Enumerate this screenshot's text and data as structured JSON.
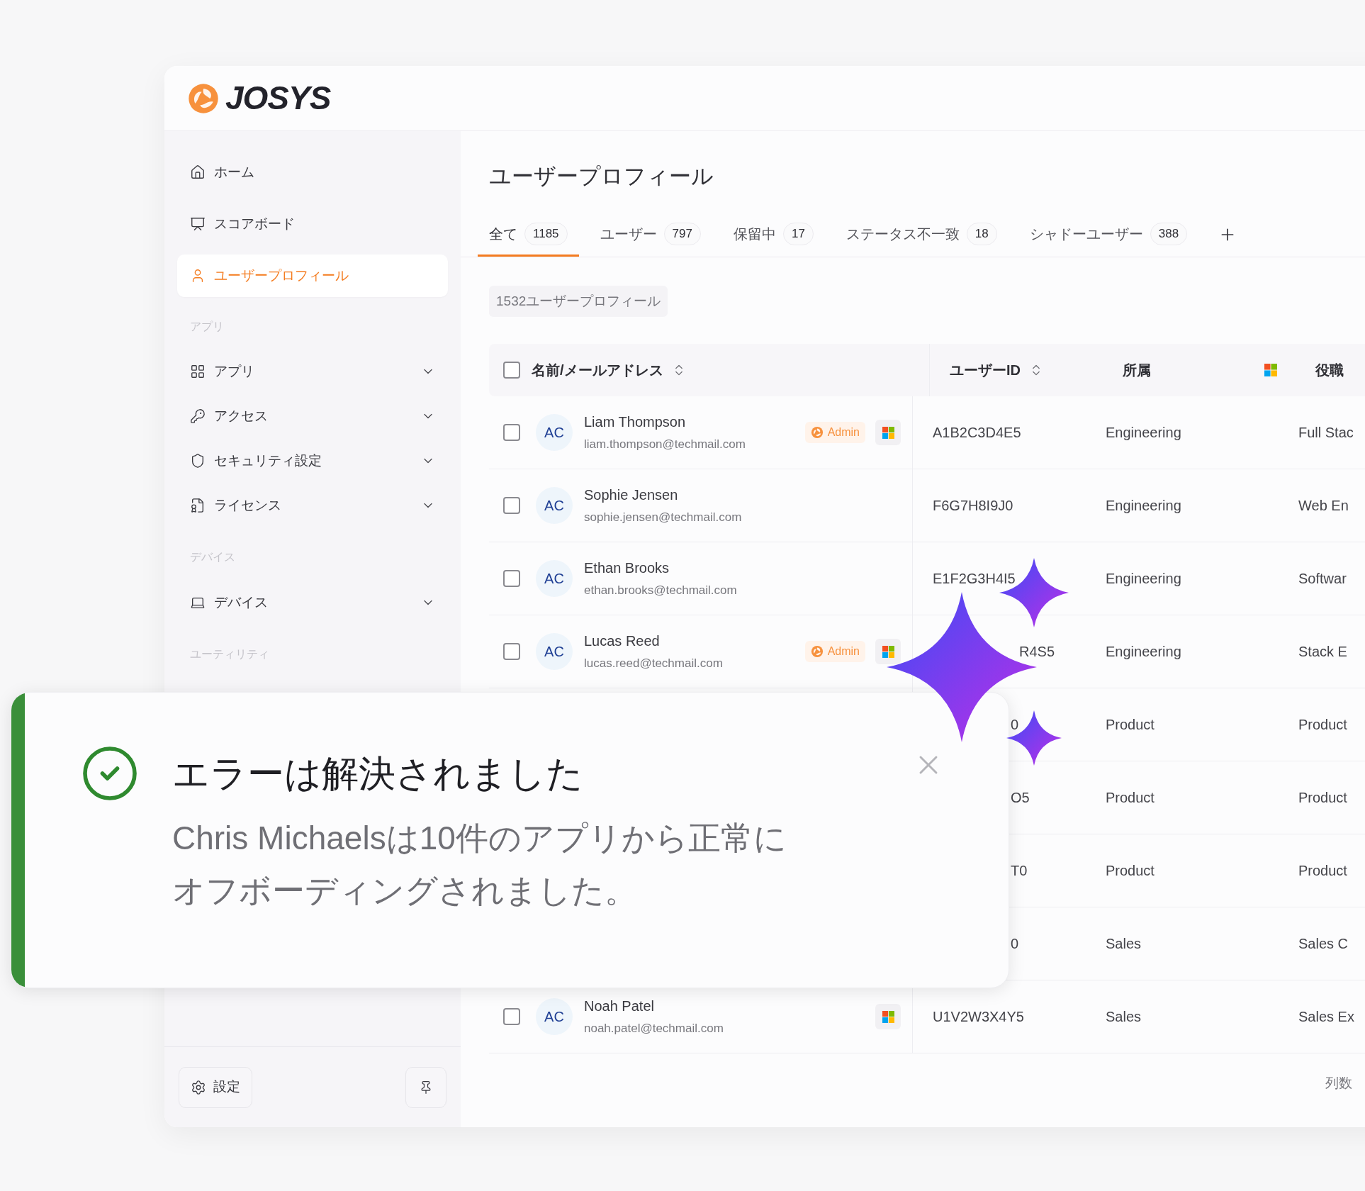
{
  "logo": {
    "text": "JOSYS"
  },
  "sidebar": {
    "sections": [
      {
        "items": [
          {
            "label": "ホーム",
            "kind": "link",
            "selected": false
          },
          {
            "label": "スコアボード",
            "kind": "link",
            "selected": false
          },
          {
            "label": "ユーザープロフィール",
            "kind": "link",
            "selected": true
          }
        ]
      },
      {
        "title": "アプリ",
        "items": [
          {
            "label": "アプリ",
            "kind": "group",
            "expanded": false
          },
          {
            "label": "アクセス",
            "kind": "group",
            "expanded": false
          },
          {
            "label": "セキュリティ設定",
            "kind": "group",
            "expanded": false
          },
          {
            "label": "ライセンス",
            "kind": "group",
            "expanded": false
          }
        ]
      },
      {
        "title": "デバイス",
        "items": [
          {
            "label": "デバイス",
            "kind": "group",
            "expanded": false
          }
        ]
      },
      {
        "title": "ユーティリティ"
      }
    ],
    "settings_button": {
      "label": "設定"
    }
  },
  "main": {
    "title": "ユーザープロフィール",
    "tabs": [
      {
        "label": "全て",
        "count": "1185",
        "selected": true
      },
      {
        "label": "ユーザー",
        "count": "797",
        "selected": false
      },
      {
        "label": "保留中",
        "count": "17",
        "selected": false
      },
      {
        "label": "ステータス不一致",
        "count": "18",
        "selected": false
      },
      {
        "label": "シャドーユーザー",
        "count": "388",
        "selected": false
      }
    ],
    "summary": "1532ユーザープロフィール",
    "table": {
      "select_all_checked": false,
      "columns": [
        {
          "label": "名前/メールアドレス",
          "sortable": true
        },
        {
          "label": "ユーザーID",
          "sortable": true
        },
        {
          "label": "所属",
          "sortable": false
        },
        {
          "kind": "microsoft"
        },
        {
          "label": "役職",
          "sortable": false
        }
      ],
      "rows": [
        {
          "kind": "full",
          "checked": false,
          "avatar": "AC",
          "name": "Liam Thompson",
          "email": "liam.thompson@techmail.com",
          "badge": "Admin",
          "microsoft": true,
          "id": "A1B2C3D4E5",
          "id_covered": false,
          "department": "Engineering",
          "role": "Full Stac"
        },
        {
          "kind": "full",
          "checked": false,
          "avatar": "AC",
          "name": "Sophie Jensen",
          "email": "sophie.jensen@techmail.com",
          "microsoft": false,
          "id": "F6G7H8I9J0",
          "id_covered": false,
          "department": "Engineering",
          "role": "Web En"
        },
        {
          "kind": "full",
          "checked": false,
          "avatar": "AC",
          "name": "Ethan Brooks",
          "email": "ethan.brooks@techmail.com",
          "microsoft": false,
          "id": "E1F2G3H4I5",
          "id_covered": false,
          "department": "Engineering",
          "role": "Softwar"
        },
        {
          "kind": "full",
          "checked": false,
          "avatar": "AC",
          "name": "Lucas Reed",
          "email": "lucas.reed@techmail.com",
          "badge": "Admin",
          "microsoft": true,
          "id": "R4S5",
          "id_covered": true,
          "department": "Engineering",
          "role": "Stack E"
        },
        {
          "kind": "covered",
          "id": "0",
          "id_covered": true,
          "department": "Product",
          "role": "Product"
        },
        {
          "kind": "covered",
          "id": "O5",
          "id_covered": true,
          "department": "Product",
          "role": "Product"
        },
        {
          "kind": "covered",
          "id": "T0",
          "id_covered": true,
          "department": "Product",
          "role": "Product"
        },
        {
          "kind": "covered",
          "id": "0",
          "id_covered": true,
          "department": "Sales",
          "role": "Sales C"
        },
        {
          "kind": "full",
          "checked": false,
          "avatar": "AC",
          "name": "Noah Patel",
          "email": "noah.patel@techmail.com",
          "microsoft": true,
          "id": "U1V2W3X4Y5",
          "id_covered": false,
          "department": "Sales",
          "role": "Sales Ex"
        }
      ]
    },
    "footer": "列数"
  },
  "toast": {
    "kind": "success",
    "title": "エラーは解決されました",
    "message": "Chris Michaelsは10件のアプリから正常にオフボーディングされました。"
  }
}
